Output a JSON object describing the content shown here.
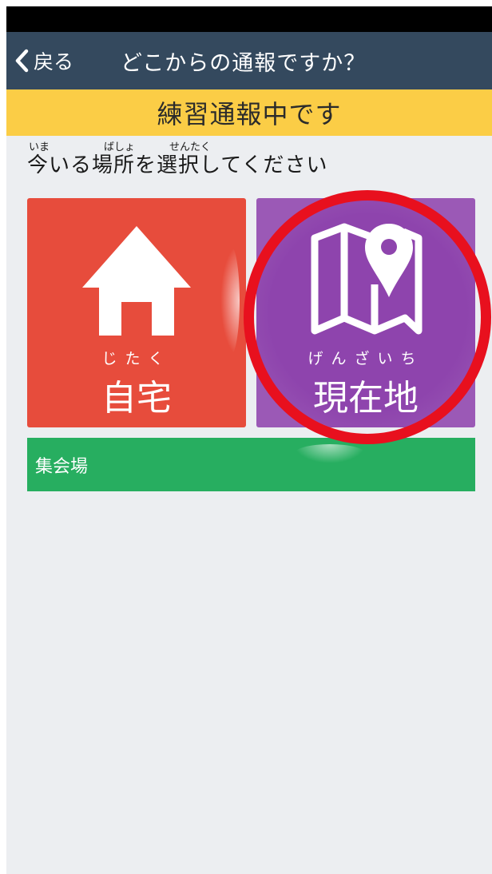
{
  "nav": {
    "back_label": "戻る",
    "title": "どこからの通報ですか？"
  },
  "banner": {
    "text": "練習通報中です"
  },
  "instruction": {
    "ruby_ima": "いま",
    "ruby_basho": "ばしょ",
    "ruby_sentaku": "せんたく",
    "text": "今いる場所を選択してください"
  },
  "tiles": {
    "home": {
      "ruby": "じたく",
      "label": "自宅",
      "icon": "house-icon",
      "color": "#e74c3c"
    },
    "current": {
      "ruby": "げんざいち",
      "label": "現在地",
      "icon": "map-pin-icon",
      "color": "#8e44ad"
    }
  },
  "locations": [
    {
      "label": "集会場",
      "color": "#27ae60"
    }
  ],
  "colors": {
    "nav": "#34495e",
    "banner": "#fbcd46",
    "highlight": "#e8101e"
  }
}
